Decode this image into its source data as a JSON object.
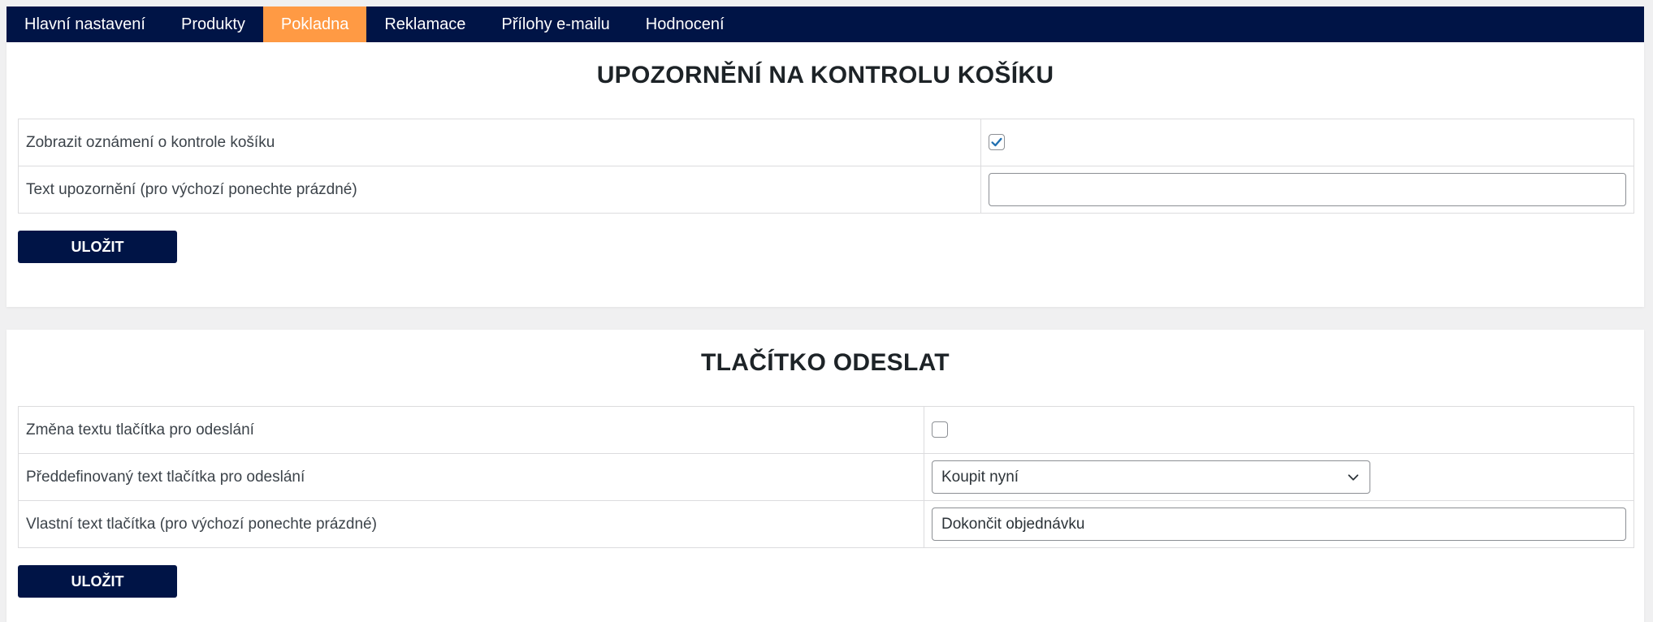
{
  "nav": {
    "tabs": [
      {
        "label": "Hlavní nastavení",
        "active": false
      },
      {
        "label": "Produkty",
        "active": false
      },
      {
        "label": "Pokladna",
        "active": true
      },
      {
        "label": "Reklamace",
        "active": false
      },
      {
        "label": "Přílohy e-mailu",
        "active": false
      },
      {
        "label": "Hodnocení",
        "active": false
      }
    ],
    "active_color": "#ff9a44",
    "bar_color": "#001446"
  },
  "cart_notice": {
    "title": "UPOZORNĚNÍ NA KONTROLU KOŠÍKU",
    "rows": [
      {
        "label": "Zobrazit oznámení o kontrole košíku",
        "checked": true
      },
      {
        "label": "Text upozornění (pro výchozí ponechte prázdné)",
        "value": "",
        "placeholder": ""
      }
    ],
    "save_label": "ULOŽIT"
  },
  "submit_button": {
    "title": "TLAČÍTKO ODESLAT",
    "rows": [
      {
        "label": "Změna textu tlačítka pro odeslání",
        "checked": false
      },
      {
        "label": "Předdefinovaný text tlačítka pro odeslání",
        "selected": "Koupit nyní"
      },
      {
        "label": "Vlastní text tlačítka (pro výchozí ponechte prázdné)",
        "value": "Dokončit objednávku"
      }
    ],
    "save_label": "ULOŽIT"
  },
  "icons": {
    "checkmark": "checkmark-icon",
    "dropdown": "chevron-down-icon"
  }
}
